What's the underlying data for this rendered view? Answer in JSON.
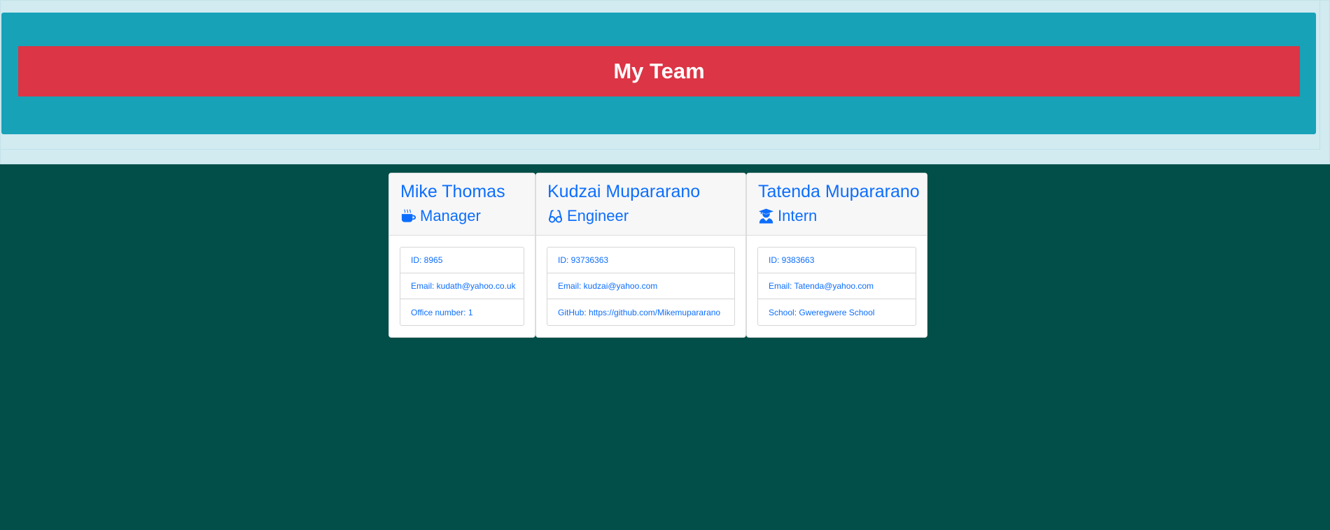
{
  "header": {
    "title": "My Team"
  },
  "team": [
    {
      "name": "Mike Thomas",
      "role": "Manager",
      "role_icon": "coffee-icon",
      "details": [
        "ID: 8965",
        "Email: kudath@yahoo.co.uk",
        "Office number: 1"
      ]
    },
    {
      "name": "Kudzai Mupararano",
      "role": "Engineer",
      "role_icon": "glasses-icon",
      "details": [
        "ID: 93736363",
        "Email: kudzai@yahoo.com",
        "GitHub: https://github.com/Mikemupararano"
      ]
    },
    {
      "name": "Tatenda Mupararano",
      "role": "Intern",
      "role_icon": "user-graduate-icon",
      "details": [
        "ID: 9383663",
        "Email: Tatenda@yahoo.com",
        "School: Gweregwere School"
      ]
    }
  ],
  "colors": {
    "page_background": "#024e48",
    "jumbotron": "#17a2b8",
    "banner": "#dc3545",
    "link_text": "#0d6efd"
  }
}
